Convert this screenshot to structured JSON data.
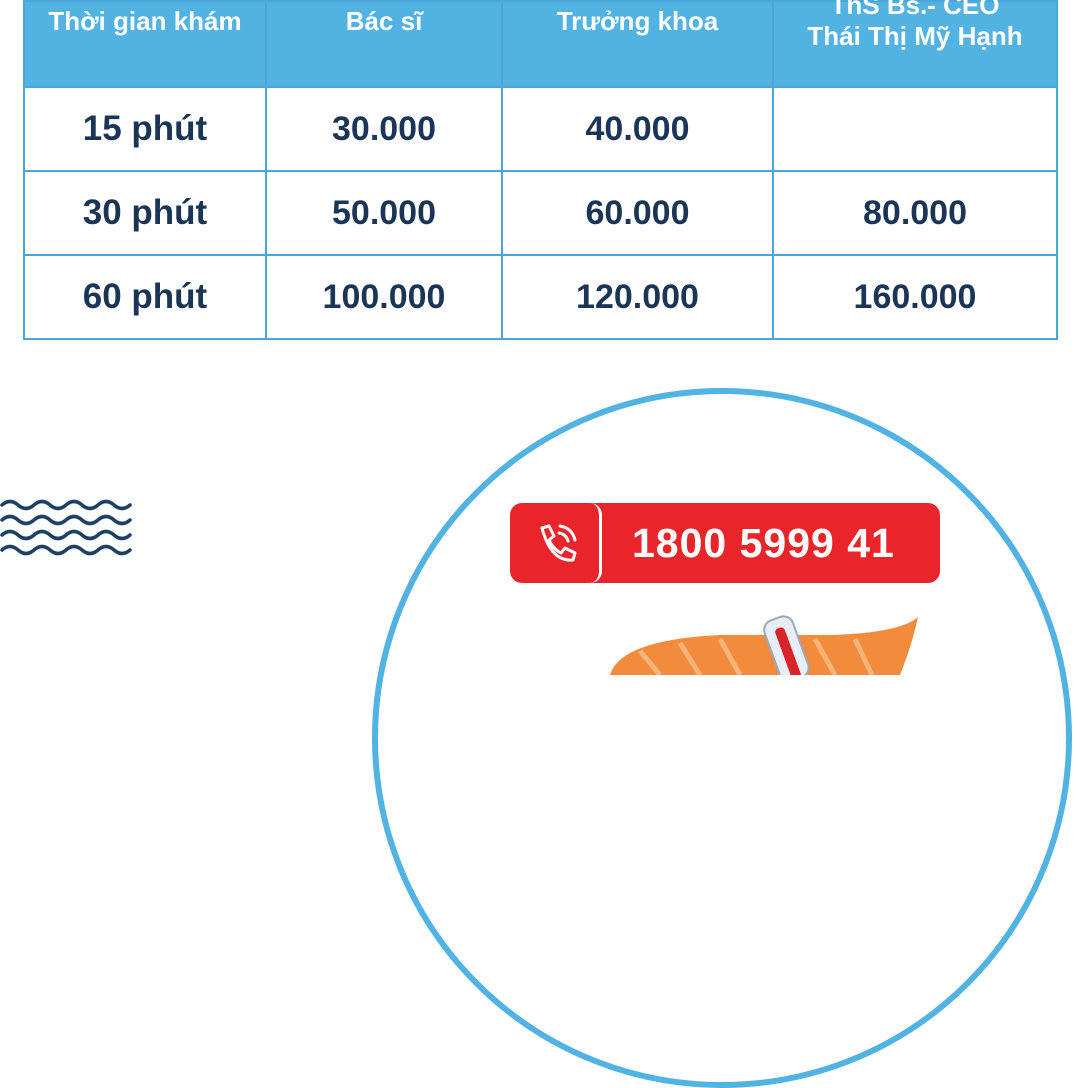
{
  "table": {
    "headers": {
      "duration": "Thời gian khám",
      "doctor": "Bác sĩ",
      "head_of_department": "Trưởng khoa",
      "ceo_line1": "ThS Bs.- CEO",
      "ceo_line2": "Thái Thị Mỹ Hạnh"
    },
    "rows": [
      {
        "duration": "15 phút",
        "doctor": "30.000",
        "head": "40.000",
        "ceo": ""
      },
      {
        "duration": "30 phút",
        "doctor": "50.000",
        "head": "60.000",
        "ceo": "80.000"
      },
      {
        "duration": "60 phút",
        "doctor": "100.000",
        "head": "120.000",
        "ceo": "160.000"
      }
    ]
  },
  "hotline": {
    "number": "1800 5999 41",
    "icon": "phone-icon"
  },
  "decorations": {
    "waves_icon": "waves-icon",
    "illustration_icon": "thermometer-illustration"
  },
  "colors": {
    "header_bg": "#52b3e3",
    "border": "#4aa6d9",
    "text_dark": "#1b3556",
    "hotline_red": "#e8252a",
    "wave_navy": "#1f3f66"
  }
}
